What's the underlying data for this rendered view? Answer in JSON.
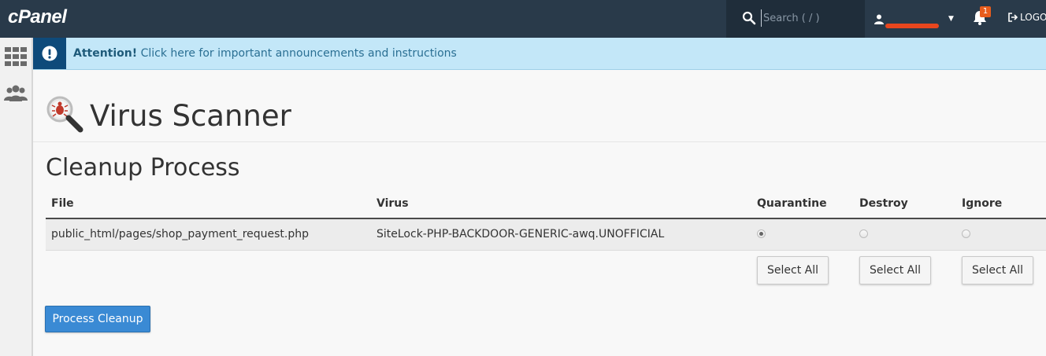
{
  "header": {
    "logo": "cPanel",
    "search": {
      "placeholder": "Search ( / )",
      "value": ""
    },
    "user": {
      "name": "",
      "caret_icon": "caret-down-icon",
      "icon": "user-icon"
    },
    "notifications": {
      "count": "1",
      "icon": "bell-icon"
    },
    "logout": {
      "label": "LOGO",
      "icon": "logout-icon"
    }
  },
  "sidebar": {
    "items": [
      {
        "icon": "grid-icon"
      },
      {
        "icon": "users-icon"
      }
    ]
  },
  "notice": {
    "icon": "exclamation-icon",
    "strong": "Attention!",
    "text": " Click here for important announcements and instructions"
  },
  "page": {
    "title": "Virus Scanner",
    "title_icon": "virus-magnifier-icon",
    "section_title": "Cleanup Process"
  },
  "table": {
    "columns": [
      "File",
      "Virus",
      "Quarantine",
      "Destroy",
      "Ignore"
    ],
    "rows": [
      {
        "file": "public_html/pages/shop_payment_request.php",
        "virus": "SiteLock-PHP-BACKDOOR-GENERIC-awq.UNOFFICIAL",
        "selected_action": "Quarantine"
      }
    ],
    "select_all_labels": [
      "Select All",
      "Select All",
      "Select All"
    ]
  },
  "actions": {
    "process_label": "Process Cleanup"
  },
  "colors": {
    "topbar": "#293a4a",
    "notice_bg": "#c3e7f8",
    "notice_icon_bg": "#0e4a7a",
    "primary": "#3a8ad4",
    "badge": "#e85c1c"
  }
}
